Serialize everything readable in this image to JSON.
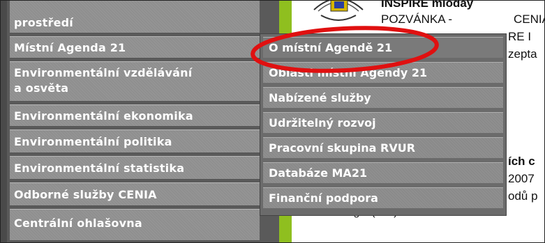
{
  "sidebar": {
    "items": [
      {
        "lines": [
          "prostředí"
        ]
      },
      {
        "lines": [
          "Místní Agenda 21"
        ]
      },
      {
        "lines": [
          "Environmentální vzdělávání",
          "a osvěta"
        ]
      },
      {
        "lines": [
          "Environmentální ekonomika"
        ]
      },
      {
        "lines": [
          "Environmentální politika"
        ]
      },
      {
        "lines": [
          "Environmentální statistika"
        ]
      },
      {
        "lines": [
          "Odborné služby CENIA"
        ]
      },
      {
        "lines": [
          "Centrální ohlašovna"
        ]
      }
    ]
  },
  "submenu": {
    "items": [
      {
        "label": "O místní Agendě 21"
      },
      {
        "label": "Oblasti místní Agendy 21"
      },
      {
        "label": "Nabízené služby"
      },
      {
        "label": "Udržitelný rozvoj"
      },
      {
        "label": "Pracovní skupina RVUR"
      },
      {
        "label": "Databáze MA21"
      },
      {
        "label": "Finanční podpora"
      }
    ]
  },
  "content": {
    "title": "INSPIRE mìoday",
    "line1_a": "POZVÁNKA  -",
    "line1_b": "CENIA",
    "line2": "RE  I",
    "line3": "zepta",
    "line4": "ích c",
    "line5": "2007",
    "line6": "odů  p",
    "line7": "technologie (ICS) v ruském Pert"
  },
  "colors": {
    "sidebar_bg": "#5a5a5a",
    "item_bg": "#8f8f8f",
    "accent_green": "#8fbf1f",
    "highlight_red": "#e01010"
  }
}
